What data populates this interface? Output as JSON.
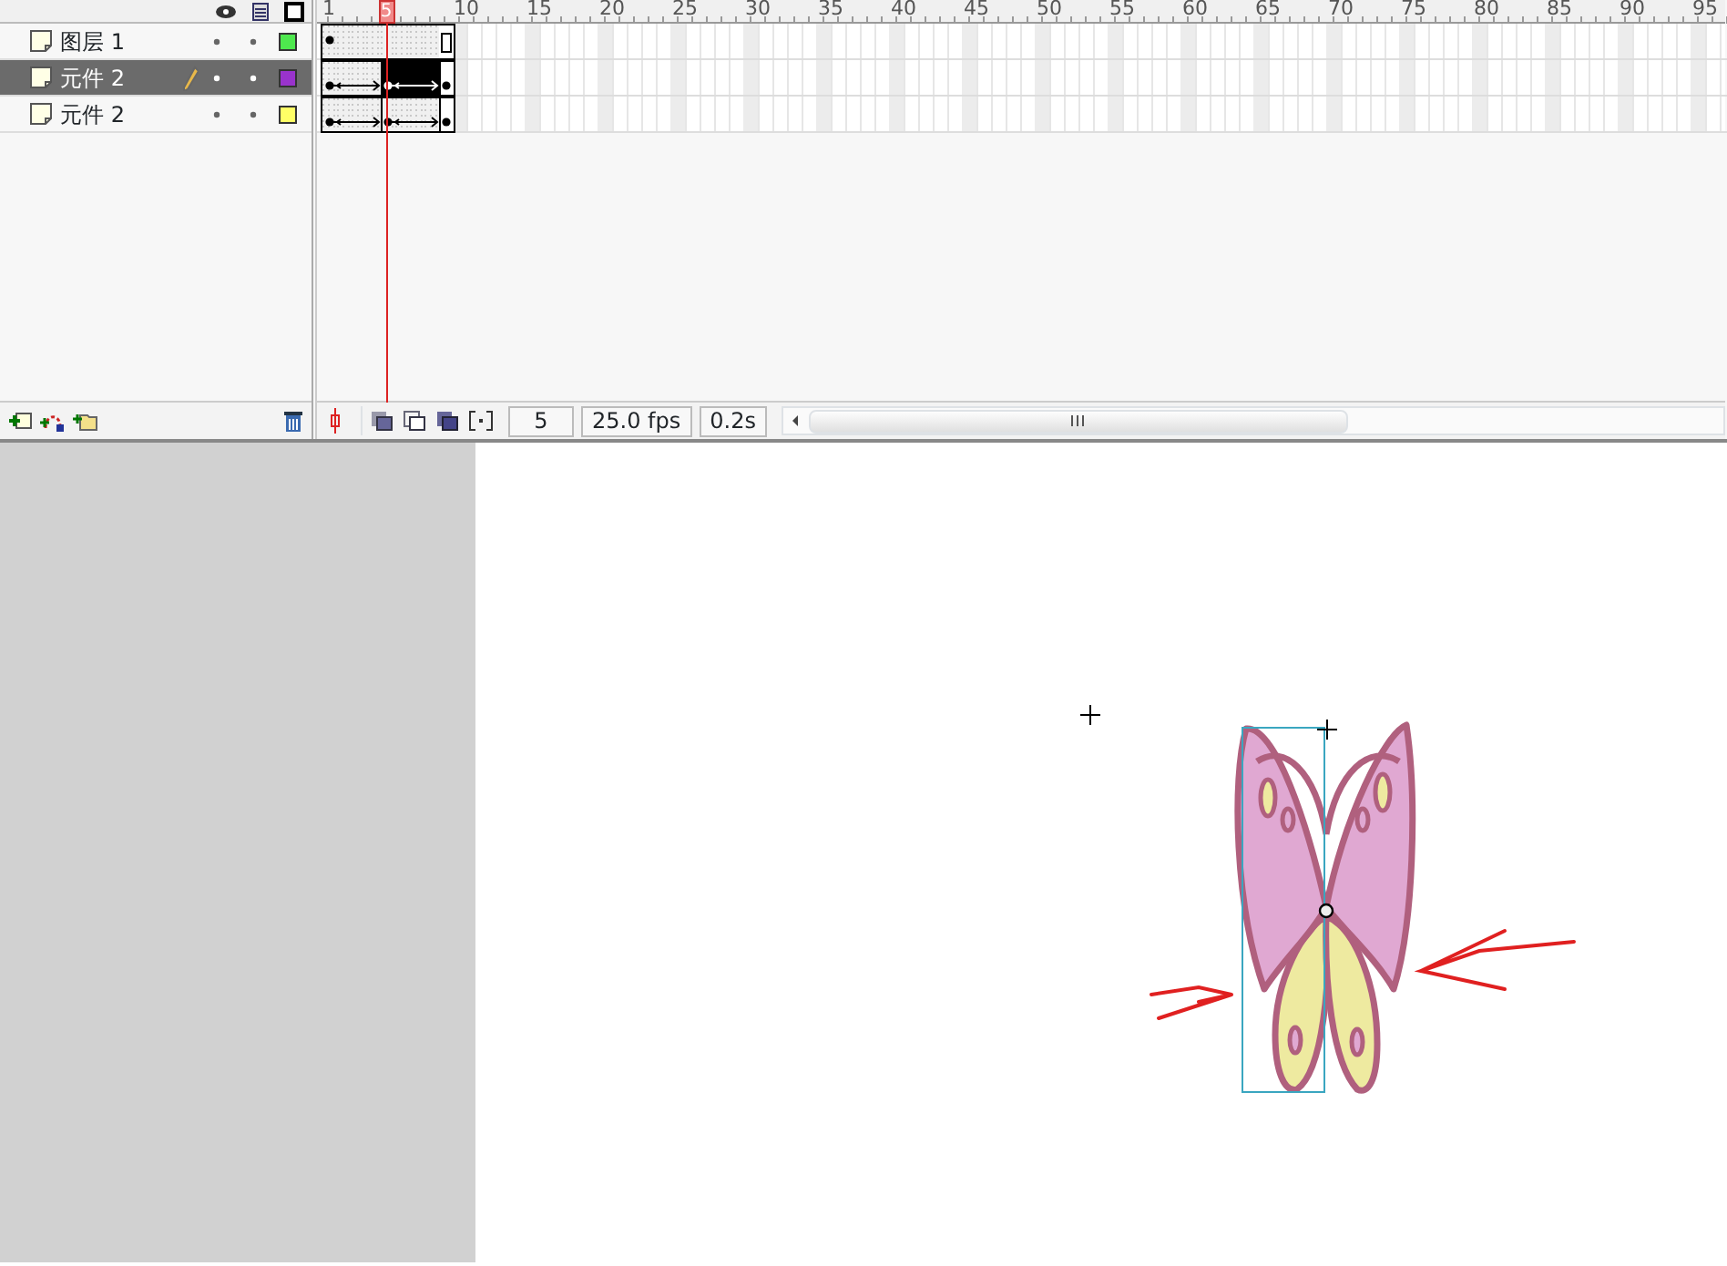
{
  "timeline": {
    "ruler": [
      "1",
      "10",
      "15",
      "20",
      "25",
      "30",
      "35",
      "40",
      "45",
      "50",
      "55",
      "60",
      "65",
      "70",
      "75",
      "80",
      "85",
      "90",
      "95"
    ],
    "playhead": {
      "label": "5"
    },
    "layers": [
      {
        "name": "图层 1",
        "selected": false,
        "editing": false,
        "color": "#4ee84e",
        "frames": [
          {
            "kind": "key",
            "selected": false
          },
          {
            "kind": "hold",
            "selected": false
          },
          {
            "kind": "hold",
            "selected": false
          },
          {
            "kind": "hold",
            "selected": false
          },
          {
            "kind": "hold",
            "selected": false
          },
          {
            "kind": "hold",
            "selected": false
          },
          {
            "kind": "hold",
            "selected": false
          },
          {
            "kind": "hold",
            "selected": false
          },
          {
            "kind": "end",
            "selected": false
          }
        ]
      },
      {
        "name": "元件 2",
        "selected": true,
        "editing": true,
        "color": "#9933cc",
        "frames": [
          {
            "kind": "key",
            "selected": false
          },
          {
            "kind": "tween",
            "selected": false
          },
          {
            "kind": "tween",
            "selected": false
          },
          {
            "kind": "tween",
            "selected": false
          },
          {
            "kind": "key",
            "selected": true
          },
          {
            "kind": "tween",
            "selected": true
          },
          {
            "kind": "tween",
            "selected": true
          },
          {
            "kind": "tween",
            "selected": true
          },
          {
            "kind": "key",
            "selected": false
          }
        ]
      },
      {
        "name": "元件 2",
        "selected": false,
        "editing": false,
        "color": "#ffff66",
        "frames": [
          {
            "kind": "key",
            "selected": false
          },
          {
            "kind": "tween",
            "selected": false
          },
          {
            "kind": "tween",
            "selected": false
          },
          {
            "kind": "tween",
            "selected": false
          },
          {
            "kind": "key",
            "selected": false
          },
          {
            "kind": "tween",
            "selected": false
          },
          {
            "kind": "tween",
            "selected": false
          },
          {
            "kind": "tween",
            "selected": false
          },
          {
            "kind": "key",
            "selected": false
          }
        ]
      }
    ],
    "status": {
      "current_frame": "5",
      "frame_rate": "25.0 fps",
      "elapsed_time": "0.2s"
    }
  }
}
